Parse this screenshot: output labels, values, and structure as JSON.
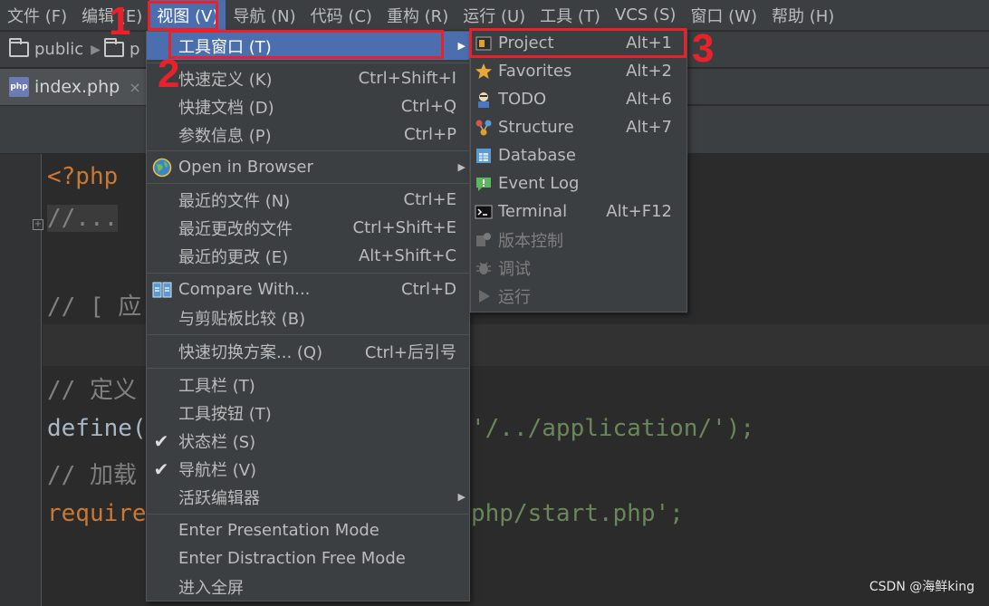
{
  "menubar": {
    "items": [
      {
        "label": "文件 (F)"
      },
      {
        "label": "编辑 (E)"
      },
      {
        "label": "视图 (V)"
      },
      {
        "label": "导航 (N)"
      },
      {
        "label": "代码 (C)"
      },
      {
        "label": "重构 (R)"
      },
      {
        "label": "运行 (U)"
      },
      {
        "label": "工具 (T)"
      },
      {
        "label": "VCS (S)"
      },
      {
        "label": "窗口 (W)"
      },
      {
        "label": "帮助 (H)"
      }
    ],
    "active_index": 2
  },
  "breadcrumb": {
    "items": [
      "public",
      "p"
    ]
  },
  "tabs": [
    {
      "label": "index.php",
      "close": "×"
    }
  ],
  "editor": {
    "lines": [
      {
        "text": "<?php"
      },
      {
        "text": "//..."
      },
      {
        "text": "// [ 应"
      },
      {
        "text": "// 定义"
      },
      {
        "text_a": "define(",
        "text_b": "'/../application/');"
      },
      {
        "text": "// 加载"
      },
      {
        "text_a": "require",
        "text_b": "php/start.php';"
      }
    ]
  },
  "view_menu": {
    "items": [
      {
        "label": "工具窗口 (T)",
        "shortcut": "",
        "submenu": true,
        "highlighted": true
      },
      {
        "label": "快速定义 (K)",
        "shortcut": "Ctrl+Shift+I"
      },
      {
        "label": "快捷文档 (D)",
        "shortcut": "Ctrl+Q"
      },
      {
        "label": "参数信息 (P)",
        "shortcut": "Ctrl+P"
      },
      {
        "label": "Open in Browser",
        "shortcut": "",
        "submenu": true,
        "icon": "globe-icon"
      },
      {
        "label": "最近的文件 (N)",
        "shortcut": "Ctrl+E"
      },
      {
        "label": "最近更改的文件",
        "shortcut": "Ctrl+Shift+E"
      },
      {
        "label": "最近的更改 (E)",
        "shortcut": "Alt+Shift+C"
      },
      {
        "label": "Compare With...",
        "shortcut": "Ctrl+D",
        "icon": "compare-icon"
      },
      {
        "label": "与剪贴板比较 (B)",
        "shortcut": ""
      },
      {
        "label": "快速切换方案... (Q)",
        "shortcut": "Ctrl+后引号"
      },
      {
        "label": "工具栏 (T)",
        "shortcut": ""
      },
      {
        "label": "工具按钮 (T)",
        "shortcut": ""
      },
      {
        "label": "状态栏 (S)",
        "shortcut": "",
        "checked": true
      },
      {
        "label": "导航栏 (V)",
        "shortcut": "",
        "checked": true
      },
      {
        "label": "活跃编辑器",
        "shortcut": "",
        "submenu": true
      },
      {
        "label": "Enter Presentation Mode",
        "shortcut": ""
      },
      {
        "label": "Enter Distraction Free Mode",
        "shortcut": ""
      },
      {
        "label": "进入全屏",
        "shortcut": ""
      }
    ]
  },
  "tool_windows_submenu": {
    "items": [
      {
        "label": "Project",
        "shortcut": "Alt+1",
        "icon": "project-icon"
      },
      {
        "label": "Favorites",
        "shortcut": "Alt+2",
        "icon": "star-icon"
      },
      {
        "label": "TODO",
        "shortcut": "Alt+6",
        "icon": "todo-icon"
      },
      {
        "label": "Structure",
        "shortcut": "Alt+7",
        "icon": "structure-icon"
      },
      {
        "label": "Database",
        "shortcut": "",
        "icon": "database-icon"
      },
      {
        "label": "Event Log",
        "shortcut": "",
        "icon": "event-log-icon"
      },
      {
        "label": "Terminal",
        "shortcut": "Alt+F12",
        "icon": "terminal-icon"
      },
      {
        "label": "版本控制",
        "shortcut": "",
        "icon": "version-control-icon",
        "disabled": true
      },
      {
        "label": "调试",
        "shortcut": "",
        "icon": "debug-icon",
        "disabled": true
      },
      {
        "label": "运行",
        "shortcut": "",
        "icon": "run-icon",
        "disabled": true
      }
    ]
  },
  "annotations": {
    "step1": "1",
    "step2": "2",
    "step3": "3",
    "color": "#e8212b"
  },
  "watermark": "CSDN @海鲜king",
  "colors": {
    "menubar_bg": "#3c3f41",
    "editor_bg": "#2b2b2b",
    "highlight": "#4b6eaf",
    "keyword": "#cc7832",
    "comment": "#808080",
    "string": "#6a8759"
  }
}
